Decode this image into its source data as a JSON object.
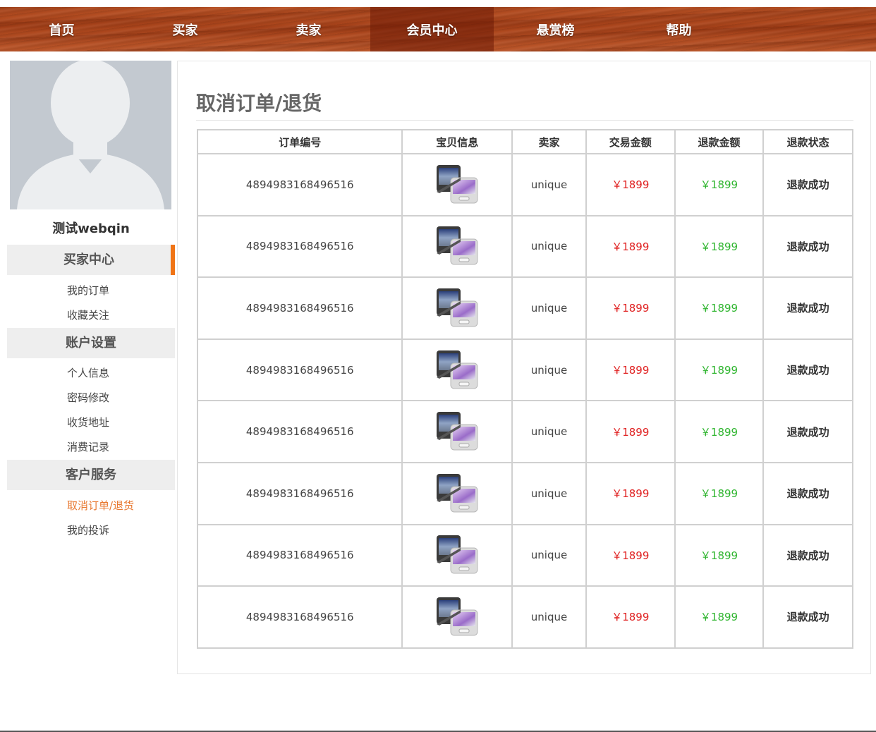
{
  "nav": {
    "items": [
      {
        "label": "首页"
      },
      {
        "label": "买家"
      },
      {
        "label": "卖家"
      },
      {
        "label": "会员中心"
      },
      {
        "label": "悬赏榜"
      },
      {
        "label": "帮助"
      }
    ],
    "active_index": 3
  },
  "sidebar": {
    "username": "测试webqin",
    "sections": [
      {
        "title": "买家中心",
        "links": [
          "我的订单",
          "收藏关注"
        ]
      },
      {
        "title": "账户设置",
        "links": [
          "个人信息",
          "密码修改",
          "收货地址",
          "消费记录"
        ]
      },
      {
        "title": "客户服务",
        "links": [
          "取消订单/退货",
          "我的投诉"
        ]
      }
    ],
    "active_link": "取消订单/退货"
  },
  "main": {
    "title": "取消订单/退货",
    "columns": [
      "订单编号",
      "宝贝信息",
      "卖家",
      "交易金额",
      "退款金额",
      "退款状态"
    ],
    "rows": [
      {
        "order_no": "4894983168496516",
        "seller": "unique",
        "trade_amount": "￥1899",
        "refund_amount": "￥1899",
        "status": "退款成功"
      },
      {
        "order_no": "4894983168496516",
        "seller": "unique",
        "trade_amount": "￥1899",
        "refund_amount": "￥1899",
        "status": "退款成功"
      },
      {
        "order_no": "4894983168496516",
        "seller": "unique",
        "trade_amount": "￥1899",
        "refund_amount": "￥1899",
        "status": "退款成功"
      },
      {
        "order_no": "4894983168496516",
        "seller": "unique",
        "trade_amount": "￥1899",
        "refund_amount": "￥1899",
        "status": "退款成功"
      },
      {
        "order_no": "4894983168496516",
        "seller": "unique",
        "trade_amount": "￥1899",
        "refund_amount": "￥1899",
        "status": "退款成功"
      },
      {
        "order_no": "4894983168496516",
        "seller": "unique",
        "trade_amount": "￥1899",
        "refund_amount": "￥1899",
        "status": "退款成功"
      },
      {
        "order_no": "4894983168496516",
        "seller": "unique",
        "trade_amount": "￥1899",
        "refund_amount": "￥1899",
        "status": "退款成功"
      },
      {
        "order_no": "4894983168496516",
        "seller": "unique",
        "trade_amount": "￥1899",
        "refund_amount": "￥1899",
        "status": "退款成功"
      }
    ]
  },
  "colors": {
    "accent_orange": "#f07416",
    "trade_red": "#e02222",
    "refund_green": "#2fb52f"
  },
  "icons": {
    "avatar": "default-user-avatar",
    "product": "phone-product-thumbnail"
  }
}
